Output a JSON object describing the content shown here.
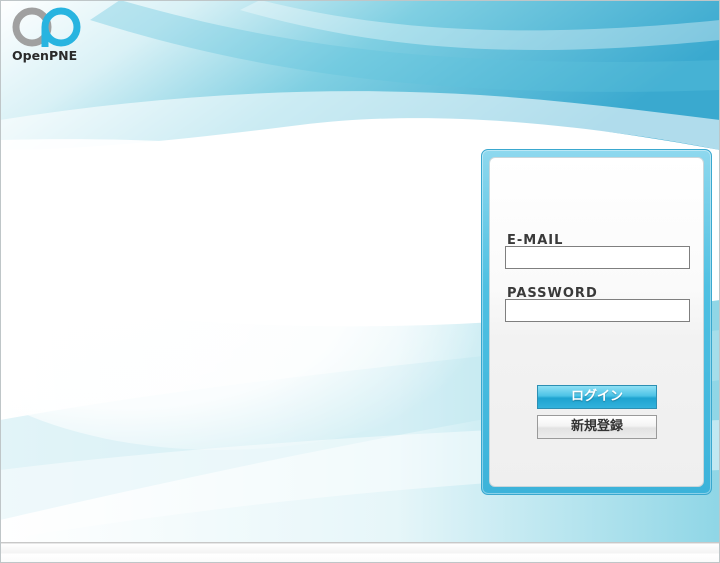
{
  "logo": {
    "text": "OpenPNE"
  },
  "login": {
    "email_label": "E-MAIL",
    "email_value": "",
    "password_label": "PASSWORD",
    "password_value": "",
    "login_button": "ログイン",
    "register_button": "新規登録"
  },
  "colors": {
    "accent": "#3cb3da",
    "logo_gray": "#a0a0a0",
    "logo_cyan": "#28b4e0"
  }
}
